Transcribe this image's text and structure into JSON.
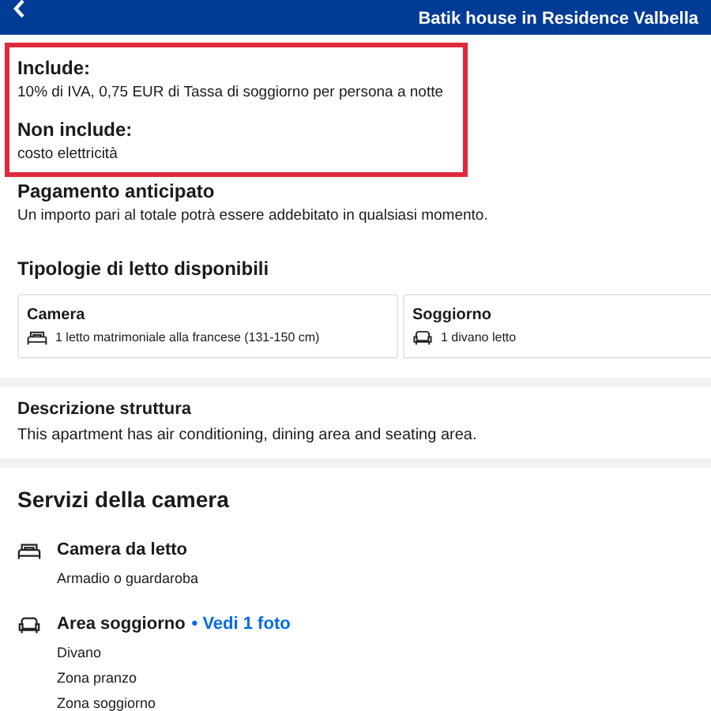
{
  "header": {
    "subtitle": "Batik house in Residence Valbella"
  },
  "policies": [
    {
      "title": "Include:",
      "text": "10% di IVA, 0,75 EUR di Tassa di soggiorno per persona a notte"
    },
    {
      "title": "Non include:",
      "text": "costo elettricità"
    },
    {
      "title": "Pagamento anticipato",
      "text": "Un importo pari al totale potrà essere addebitato in qualsiasi momento."
    }
  ],
  "bed_types": {
    "title": "Tipologie di letto disponibili",
    "rooms": [
      {
        "name": "Camera",
        "kind": "bed",
        "bed": "1 letto matrimoniale alla francese (131-150 cm)"
      },
      {
        "name": "Soggiorno",
        "kind": "sofa",
        "bed": "1 divano letto"
      }
    ]
  },
  "description": {
    "title": "Descrizione struttura",
    "text": "This apartment has air conditioning, dining area and seating area."
  },
  "amenities": {
    "title": "Servizi della camera",
    "groups": [
      {
        "kind": "bed",
        "name": "Camera da letto",
        "items": [
          "Armadio o guardaroba"
        ]
      },
      {
        "kind": "sofa",
        "name": "Area soggiorno",
        "link": "• Vedi 1 foto",
        "items": [
          "Divano",
          "Zona pranzo",
          "Zona soggiorno"
        ]
      }
    ]
  }
}
